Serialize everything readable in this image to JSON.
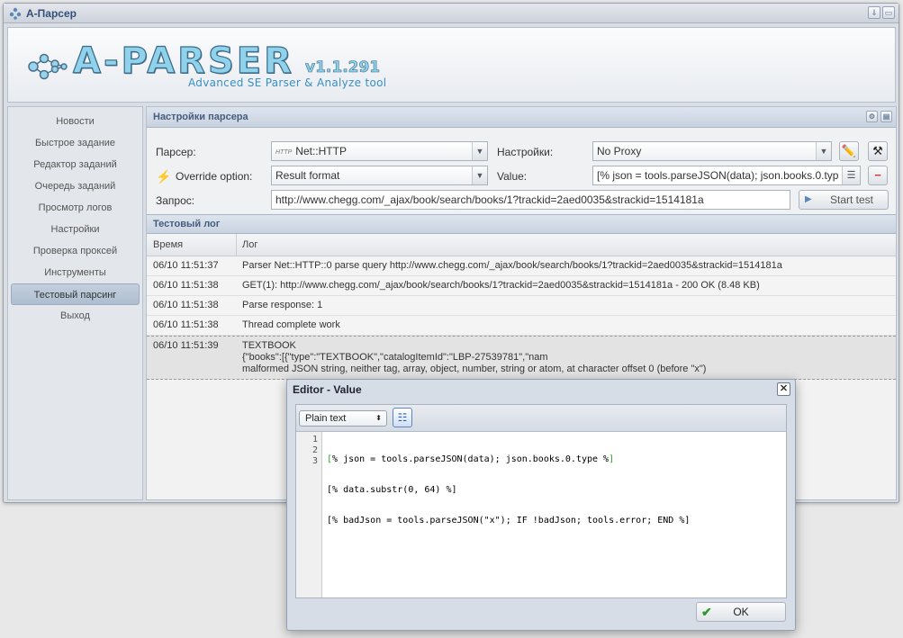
{
  "window": {
    "title": "A-Парсер"
  },
  "banner": {
    "logo": "A-PARSER",
    "version": "v1.1.291",
    "subtitle": "Advanced SE Parser & Analyze tool"
  },
  "sidebar": {
    "items": [
      {
        "label": "Новости"
      },
      {
        "label": "Быстрое задание"
      },
      {
        "label": "Редактор заданий"
      },
      {
        "label": "Очередь заданий"
      },
      {
        "label": "Просмотр логов"
      },
      {
        "label": "Настройки"
      },
      {
        "label": "Проверка проксей"
      },
      {
        "label": "Инструменты"
      },
      {
        "label": "Тестовый парсинг",
        "active": true
      },
      {
        "label": "Выход"
      }
    ]
  },
  "settings": {
    "title": "Настройки парсера",
    "parser_label": "Парсер:",
    "parser_value": "Net::HTTP",
    "parser_icon_text": "HTTP",
    "settings_label": "Настройки:",
    "settings_value": "No Proxy",
    "override_label": "Override option:",
    "override_value": "Result format",
    "value_label": "Value:",
    "value_value": "[% json = tools.parseJSON(data); json.books.0.typ",
    "query_label": "Запрос:",
    "query_value": "http://www.chegg.com/_ajax/book/search/books/1?trackid=2aed0035&strackid=1514181a",
    "start_button": "Start test"
  },
  "log": {
    "title": "Тестовый лог",
    "col_time": "Время",
    "col_log": "Лог",
    "rows": [
      {
        "time": "06/10 11:51:37",
        "lines": [
          "Parser Net::HTTP::0 parse query http://www.chegg.com/_ajax/book/search/books/1?trackid=2aed0035&strackid=1514181a"
        ]
      },
      {
        "time": "06/10 11:51:38",
        "lines": [
          "GET(1): http://www.chegg.com/_ajax/book/search/books/1?trackid=2aed0035&strackid=1514181a - 200 OK (8.48 KB)"
        ]
      },
      {
        "time": "06/10 11:51:38",
        "lines": [
          "Parse response: 1"
        ]
      },
      {
        "time": "06/10 11:51:38",
        "lines": [
          "Thread complete work"
        ]
      },
      {
        "time": "06/10 11:51:39",
        "lines": [
          "TEXTBOOK",
          "{\"books\":[{\"type\":\"TEXTBOOK\",\"catalogItemId\":\"LBP-27539781\",\"nam",
          "malformed JSON string, neither tag, array, object, number, string or atom, at character offset 0 (before \"x\")"
        ]
      }
    ]
  },
  "editor": {
    "title": "Editor - Value",
    "mode": "Plain text",
    "lines": [
      {
        "num": "1",
        "open": "[",
        "body": "% json = tools.parseJSON(data); json.books.0.type %",
        "close": "]"
      },
      {
        "num": "2",
        "open": "[",
        "body": "% data.substr(0, 64) %",
        "close": "]"
      },
      {
        "num": "3",
        "open": "[",
        "body": "% badJson = tools.parseJSON(\"x\"); IF !badJson; tools.error; END %",
        "close": "]"
      }
    ],
    "ok_button": "OK"
  }
}
